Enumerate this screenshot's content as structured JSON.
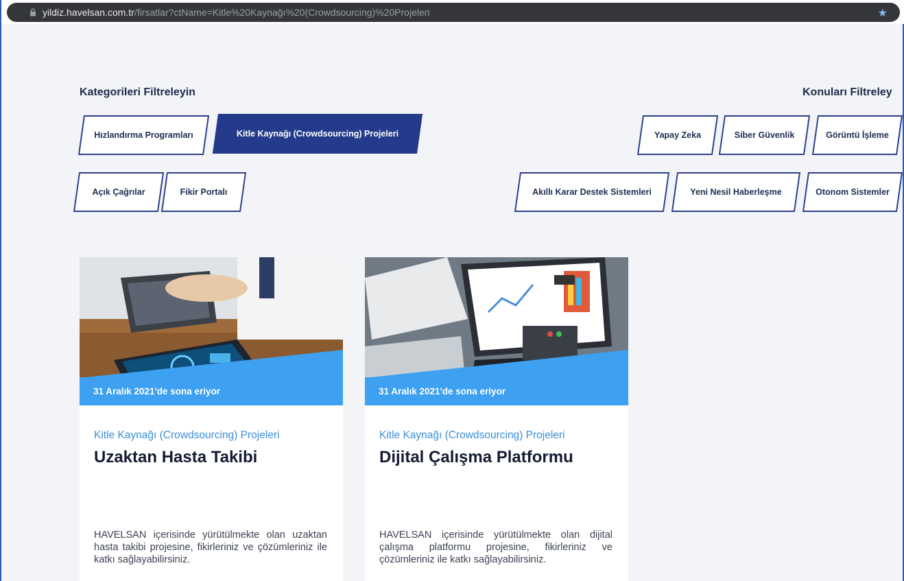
{
  "browser": {
    "url_host": "yildiz.havelsan.com.tr",
    "url_path": "/firsatlar?ctName=Kitle%20Kaynağı%20(Crowdsourcing)%20Projeleri"
  },
  "filters": {
    "categories_title": "Kategorileri Filtreleyin",
    "topics_title": "Konuları Filtreley",
    "categories": [
      {
        "label": "Hızlandırma Programları",
        "active": false
      },
      {
        "label": "Kitle Kaynağı (Crowdsourcing) Projeleri",
        "active": true
      },
      {
        "label": "Açık Çağrılar",
        "active": false
      },
      {
        "label": "Fikir Portalı",
        "active": false
      }
    ],
    "topics": [
      {
        "label": "Yapay Zeka"
      },
      {
        "label": "Siber Güvenlik"
      },
      {
        "label": "Görüntü İşleme"
      },
      {
        "label": "Akıllı Karar Destek Sistemleri"
      },
      {
        "label": "Yeni Nesil Haberleşme"
      },
      {
        "label": "Otonom Sistemler"
      }
    ]
  },
  "cards": [
    {
      "deadline": "31 Aralık 2021'de sona eriyor",
      "category": "Kitle Kaynağı (Crowdsourcing) Projeleri",
      "title": "Uzaktan Hasta Takibi",
      "description": "HAVELSAN içerisinde yürütülmekte olan uzaktan hasta takibi projesine, fikirleriniz ve çözümleriniz ile katkı sağlayabilirsiniz."
    },
    {
      "deadline": "31 Aralık 2021'de sona eriyor",
      "category": "Kitle Kaynağı (Crowdsourcing) Projeleri",
      "title": "Dijital Çalışma Platformu",
      "description": "HAVELSAN içerisinde yürütülmekte olan dijital çalışma platformu projesine, fikirleriniz ve çözümleriniz ile katkı sağlayabilirsiniz."
    }
  ],
  "colors": {
    "accent_blue": "#3da0f0",
    "navy": "#243a8a",
    "background": "#f2f4f7"
  }
}
